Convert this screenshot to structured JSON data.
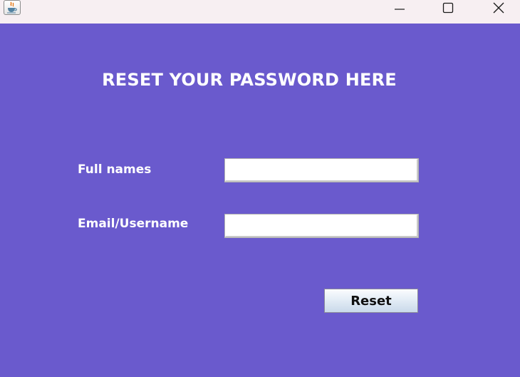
{
  "titlebar": {
    "app_icon": "java-coffee-cup-icon",
    "controls": [
      "minimize-icon",
      "maximize-icon",
      "close-icon"
    ]
  },
  "form": {
    "heading": "RESET YOUR PASSWORD HERE",
    "fullname_label": "Full names",
    "fullname_value": "",
    "email_label": "Email/Username",
    "email_value": "",
    "reset_label": "Reset"
  },
  "colors": {
    "background": "#6a5acd",
    "titlebar": "#f7eff2",
    "text": "#ffffff"
  }
}
